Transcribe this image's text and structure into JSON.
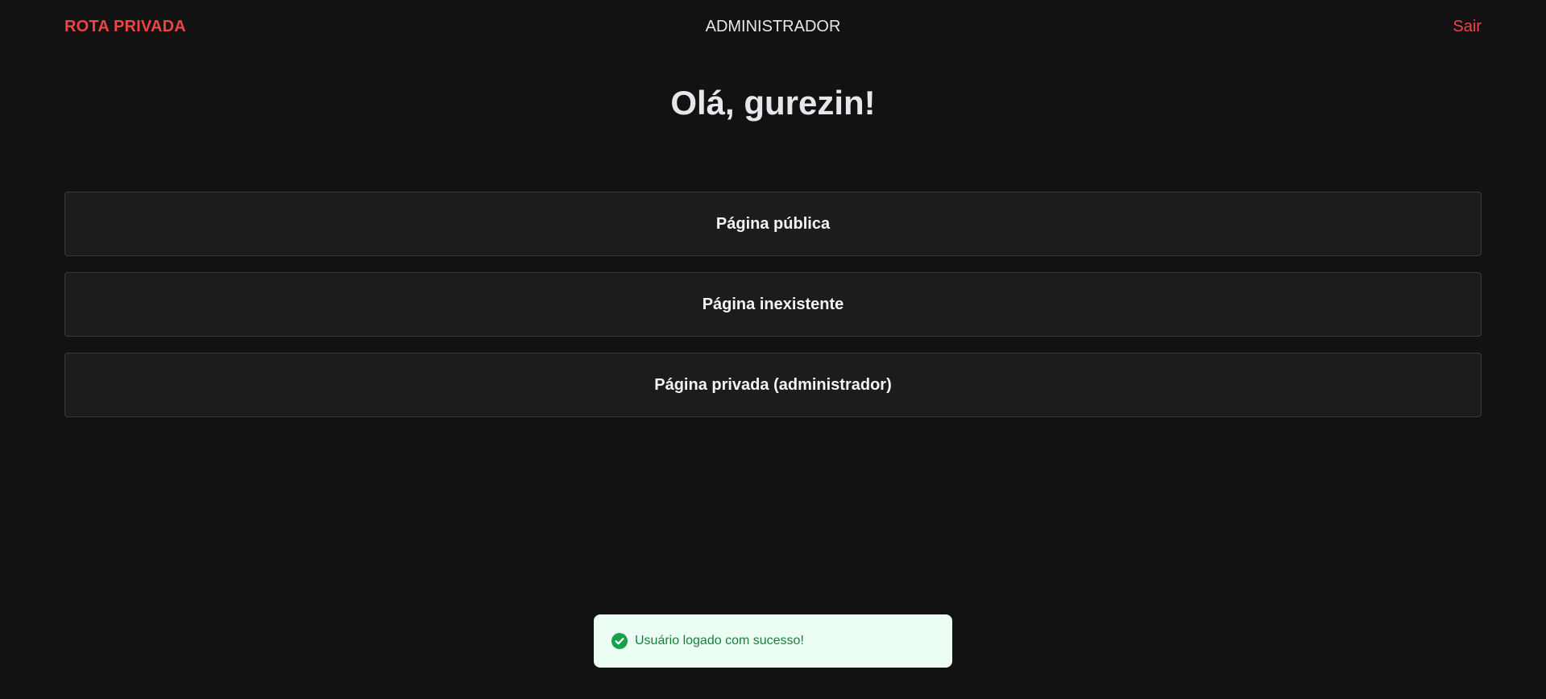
{
  "header": {
    "brand": "ROTA PRIVADA",
    "role": "ADMINISTRADOR",
    "logout_label": "Sair"
  },
  "main": {
    "greeting": "Olá, gurezin!",
    "links": [
      {
        "label": "Página pública"
      },
      {
        "label": "Página inexistente"
      },
      {
        "label": "Página privada (administrador)"
      }
    ]
  },
  "toast": {
    "message": "Usuário logado com sucesso!",
    "icon": "check-circle-icon"
  },
  "colors": {
    "background": "#121212",
    "accent": "#ef4444",
    "card_background": "#1c1c1c",
    "card_border": "#3a3a3a",
    "toast_background": "#ecfdf3",
    "toast_text": "#15803d"
  }
}
